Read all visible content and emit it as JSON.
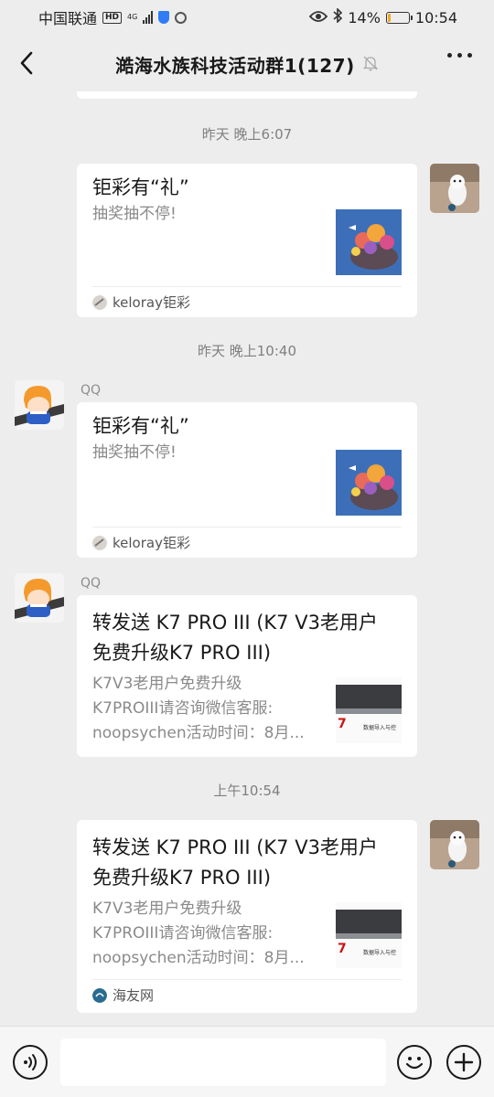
{
  "status": {
    "carrier": "中国联通",
    "hd": "HD",
    "network": "4G",
    "battery": "14%",
    "battery_level": 0.14,
    "time": "10:54"
  },
  "header": {
    "title": "澔海水族科技活动群1(127)"
  },
  "messages": [
    {
      "timestamp": "昨天 晚上6:07",
      "title": "钜彩有“礼”",
      "desc": [
        "抽奖抽不停!"
      ],
      "source": "keloray钜彩"
    },
    {
      "timestamp": "昨天 晚上10:40",
      "sender": "QQ",
      "title": "钜彩有“礼”",
      "desc": [
        "抽奖抽不停!"
      ],
      "source": "keloray钜彩"
    },
    {
      "sender": "QQ",
      "title": "转发送 K7 PRO III (K7 V3老用户免费升级K7 PRO III)",
      "title_lines": [
        "转发送 K7 PRO III (K7 V3老用户",
        "免费升级K7 PRO III)"
      ],
      "desc": [
        "K7V3老用户免费升级",
        "K7PROIII请咨询微信客服:",
        "noopsychen活动时间：8月..."
      ]
    },
    {
      "timestamp": "上午10:54",
      "title_lines": [
        "转发送 K7 PRO III (K7 V3老用户",
        "免费升级K7 PRO III)"
      ],
      "desc": [
        "K7V3老用户免费升级",
        "K7PROIII请咨询微信客服:",
        "noopsychen活动时间：8月..."
      ],
      "source": "海友网"
    }
  ],
  "thumb_text": {
    "k7": "7",
    "caption": "数据导入与控"
  },
  "colors": {
    "background": "#ededed",
    "card": "#ffffff",
    "timestamp": "#7f7f7f",
    "thumb_blue": "#3d6fb8"
  },
  "icons": [
    "back-icon",
    "mute-icon",
    "more-icon",
    "eye-icon",
    "bluetooth-icon",
    "voice-icon",
    "emoji-icon",
    "plus-icon"
  ]
}
